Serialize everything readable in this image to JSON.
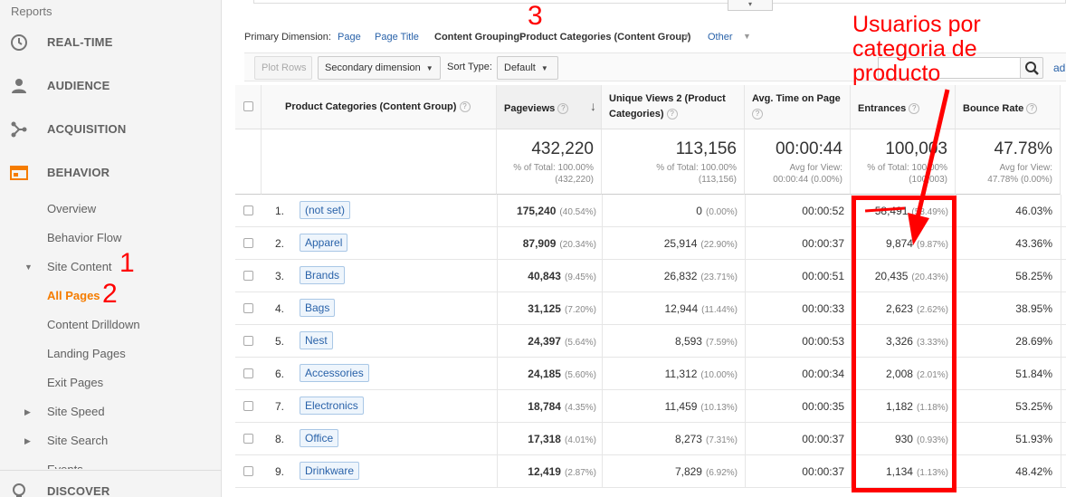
{
  "sidebar": {
    "reports": "Reports",
    "sections": [
      {
        "label": "REAL-TIME",
        "icon": "clock-icon"
      },
      {
        "label": "AUDIENCE",
        "icon": "person-icon"
      },
      {
        "label": "ACQUISITION",
        "icon": "acquisition-icon"
      },
      {
        "label": "BEHAVIOR",
        "icon": "behavior-icon"
      },
      {
        "label": "DISCOVER",
        "icon": "lightbulb-icon"
      }
    ],
    "behavior_items": [
      "Overview",
      "Behavior Flow",
      "Site Content",
      "All Pages",
      "Content Drilldown",
      "Landing Pages",
      "Exit Pages",
      "Site Speed",
      "Site Search",
      "Events"
    ]
  },
  "dimension_bar": {
    "label": "Primary Dimension:",
    "page": "Page",
    "page_title": "Page Title",
    "content_grouping_label": "Content Grouping:",
    "content_grouping_value": "Product Categories (Content Group)",
    "other": "Other"
  },
  "toolbar": {
    "plot_rows": "Plot Rows",
    "secondary_dimension": "Secondary dimension",
    "sort_type_label": "Sort Type:",
    "sort_type_value": "Default",
    "advanced": "ad"
  },
  "table": {
    "headers": {
      "category": "Product Categories (Content Group)",
      "pageviews": "Pageviews",
      "unique_views": "Unique Views 2 (Product Categories)",
      "avg_time": "Avg. Time on Page",
      "entrances": "Entrances",
      "bounce": "Bounce Rate"
    },
    "totals": {
      "pageviews": "432,220",
      "pageviews_sub1": "% of Total: 100.00%",
      "pageviews_sub2": "(432,220)",
      "unique": "113,156",
      "unique_sub1": "% of Total: 100.00%",
      "unique_sub2": "(113,156)",
      "avg_time": "00:00:44",
      "avg_sub1": "Avg for View:",
      "avg_sub2": "00:00:44 (0.00%)",
      "entrances": "100,003",
      "entr_sub1": "% of Total: 100.00%",
      "entr_sub2": "(100,003)",
      "bounce": "47.78%",
      "bounce_sub1": "Avg for View:",
      "bounce_sub2": "47.78% (0.00%)"
    },
    "rows": [
      {
        "rank": "1.",
        "name": "(not set)",
        "pv": "175,240",
        "pv_pct": "(40.54%)",
        "uv": "0",
        "uv_pct": "(0.00%)",
        "time": "00:00:52",
        "ent": "58,491",
        "ent_pct": "(58.49%)",
        "bounce": "46.03%"
      },
      {
        "rank": "2.",
        "name": "Apparel",
        "pv": "87,909",
        "pv_pct": "(20.34%)",
        "uv": "25,914",
        "uv_pct": "(22.90%)",
        "time": "00:00:37",
        "ent": "9,874",
        "ent_pct": "(9.87%)",
        "bounce": "43.36%"
      },
      {
        "rank": "3.",
        "name": "Brands",
        "pv": "40,843",
        "pv_pct": "(9.45%)",
        "uv": "26,832",
        "uv_pct": "(23.71%)",
        "time": "00:00:51",
        "ent": "20,435",
        "ent_pct": "(20.43%)",
        "bounce": "58.25%"
      },
      {
        "rank": "4.",
        "name": "Bags",
        "pv": "31,125",
        "pv_pct": "(7.20%)",
        "uv": "12,944",
        "uv_pct": "(11.44%)",
        "time": "00:00:33",
        "ent": "2,623",
        "ent_pct": "(2.62%)",
        "bounce": "38.95%"
      },
      {
        "rank": "5.",
        "name": "Nest",
        "pv": "24,397",
        "pv_pct": "(5.64%)",
        "uv": "8,593",
        "uv_pct": "(7.59%)",
        "time": "00:00:53",
        "ent": "3,326",
        "ent_pct": "(3.33%)",
        "bounce": "28.69%"
      },
      {
        "rank": "6.",
        "name": "Accessories",
        "pv": "24,185",
        "pv_pct": "(5.60%)",
        "uv": "11,312",
        "uv_pct": "(10.00%)",
        "time": "00:00:34",
        "ent": "2,008",
        "ent_pct": "(2.01%)",
        "bounce": "51.84%"
      },
      {
        "rank": "7.",
        "name": "Electronics",
        "pv": "18,784",
        "pv_pct": "(4.35%)",
        "uv": "11,459",
        "uv_pct": "(10.13%)",
        "time": "00:00:35",
        "ent": "1,182",
        "ent_pct": "(1.18%)",
        "bounce": "53.25%"
      },
      {
        "rank": "8.",
        "name": "Office",
        "pv": "17,318",
        "pv_pct": "(4.01%)",
        "uv": "8,273",
        "uv_pct": "(7.31%)",
        "time": "00:00:37",
        "ent": "930",
        "ent_pct": "(0.93%)",
        "bounce": "51.93%"
      },
      {
        "rank": "9.",
        "name": "Drinkware",
        "pv": "12,419",
        "pv_pct": "(2.87%)",
        "uv": "7,829",
        "uv_pct": "(6.92%)",
        "time": "00:00:37",
        "ent": "1,134",
        "ent_pct": "(1.13%)",
        "bounce": "48.42%"
      }
    ]
  },
  "annotations": {
    "n1": "1",
    "n2": "2",
    "n3": "3",
    "callout": [
      "Usuarios por",
      "categoria de",
      "producto"
    ],
    "color": "#ff0000"
  }
}
